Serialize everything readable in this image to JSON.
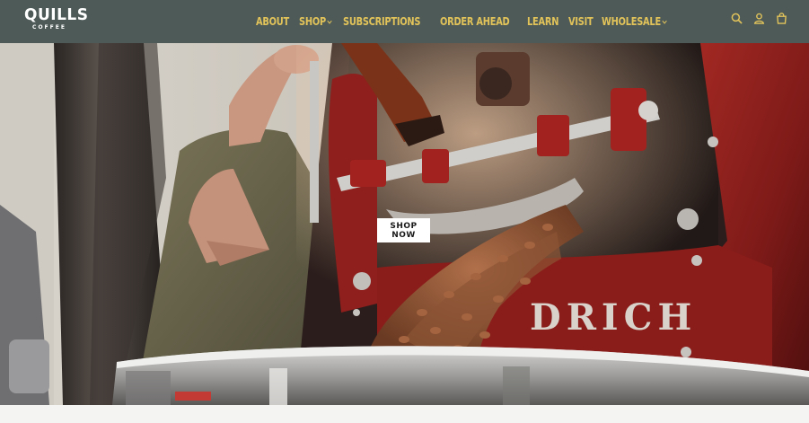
{
  "brand": {
    "name": "QUILLS",
    "tagline": "COFFEE"
  },
  "nav": {
    "items": [
      {
        "label": "ABOUT",
        "has_dropdown": false
      },
      {
        "label": "SHOP",
        "has_dropdown": true
      },
      {
        "label": "SUBSCRIPTIONS",
        "has_dropdown": false
      },
      {
        "label": "ORDER AHEAD",
        "has_dropdown": false
      },
      {
        "label": "LEARN",
        "has_dropdown": false
      },
      {
        "label": "VISIT",
        "has_dropdown": false
      },
      {
        "label": "WHOLESALE",
        "has_dropdown": true
      }
    ]
  },
  "header_icons": [
    "search-icon",
    "account-icon",
    "cart-icon"
  ],
  "hero": {
    "cta_label": "SHOP NOW",
    "roaster_lettering": "DRICH"
  },
  "colors": {
    "header_bg": "#4d5a58",
    "nav_text": "#e2c35a",
    "roaster_red": "#8e1f1c",
    "page_bg": "#f4f4f2"
  }
}
